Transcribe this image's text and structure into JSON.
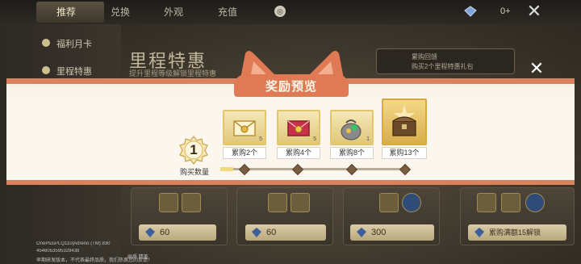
{
  "topbar": {
    "tabs": [
      {
        "label": "推荐",
        "active": true
      },
      {
        "label": "兑换",
        "active": false
      },
      {
        "label": "外观",
        "active": false
      },
      {
        "label": "充值",
        "active": false
      }
    ],
    "currency_value": "0+",
    "close_icon": "close-icon"
  },
  "sidebar": {
    "items": [
      {
        "label": "福利月卡"
      },
      {
        "label": "里程特惠"
      }
    ]
  },
  "banner": {
    "title": "里程特惠",
    "subtitle": "提升里程等级解锁里程特惠"
  },
  "quest": {
    "line1": "累购回馈",
    "line2": "购买2个里程特惠礼包"
  },
  "cards": [
    {
      "price": "60"
    },
    {
      "price": "60"
    },
    {
      "price": "300"
    },
    {
      "price": "累购满额15解锁"
    }
  ],
  "modal": {
    "title": "奖励预览",
    "purchase_count": "1",
    "purchase_count_label": "购买数量",
    "progress": 0.07,
    "rewards": [
      {
        "label": "累购2个",
        "count": "5",
        "icon": "envelope-icon"
      },
      {
        "label": "累购4个",
        "count": "5",
        "icon": "red-envelope-icon"
      },
      {
        "label": "累购8个",
        "count": "1",
        "icon": "treasure-bag-icon"
      },
      {
        "label": "累购13个",
        "count": "",
        "icon": "treasure-chest-icon"
      }
    ]
  },
  "system_overlay": {
    "line1": "OnePlusPLQ110|Adreno (TM) 830",
    "line2": "4546053595329438",
    "line3": "早期研发版本，不代表最终品质，我们热衷您的反馈！",
    "line4": "画质 精美"
  },
  "colors": {
    "modal_border": "#d9825c",
    "modal_header": "#e07a55",
    "reward_gold": "#e2c66d",
    "progress_fill": "#f0d978"
  }
}
